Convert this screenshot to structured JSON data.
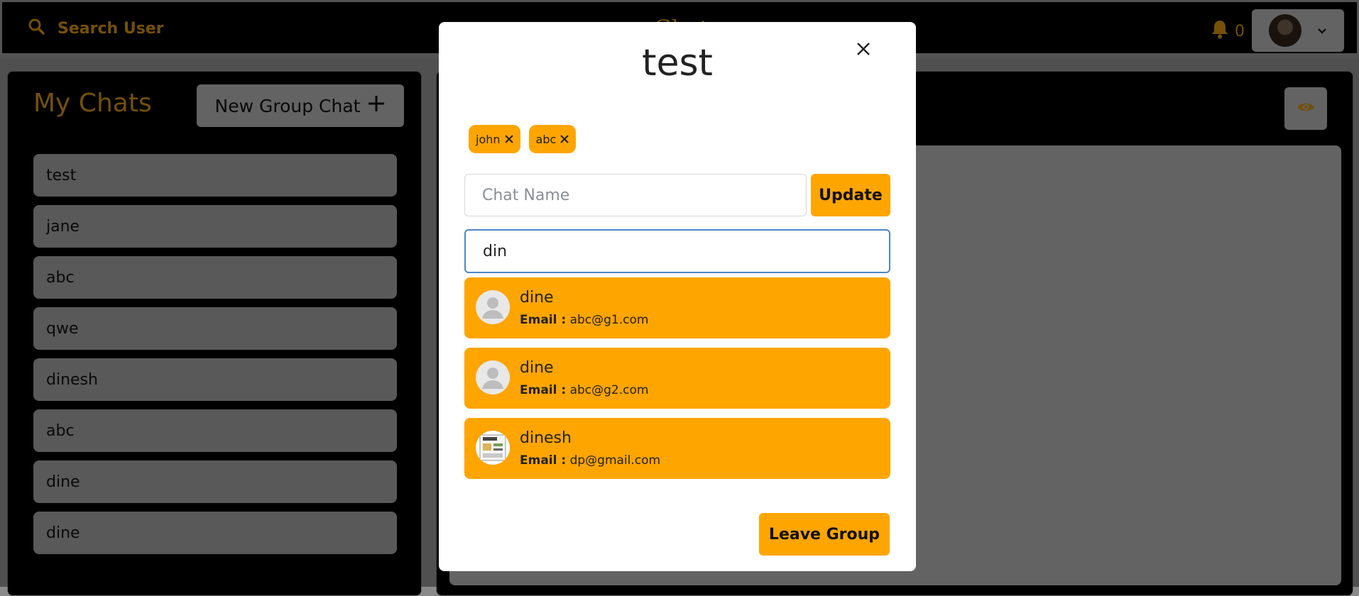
{
  "header": {
    "search_label": "Search User",
    "app_title": "Chat",
    "notification_count": "0",
    "accent_color": "#c88a12"
  },
  "sidebar": {
    "title": "My Chats",
    "new_group_label": "New Group Chat",
    "chats": [
      {
        "label": "test"
      },
      {
        "label": "jane"
      },
      {
        "label": "abc"
      },
      {
        "label": "qwe"
      },
      {
        "label": "dinesh"
      },
      {
        "label": "abc"
      },
      {
        "label": "dine"
      },
      {
        "label": "dine"
      }
    ]
  },
  "modal": {
    "title": "test",
    "members": [
      {
        "name": "john"
      },
      {
        "name": "abc"
      }
    ],
    "chat_name_placeholder": "Chat Name",
    "chat_name_value": "",
    "update_label": "Update",
    "add_user_value": "din",
    "search_results": [
      {
        "name": "dine",
        "email_label": "Email :",
        "email": "abc@g1.com",
        "avatar": "default-avatar-icon"
      },
      {
        "name": "dine",
        "email_label": "Email :",
        "email": "abc@g2.com",
        "avatar": "default-avatar-icon"
      },
      {
        "name": "dinesh",
        "email_label": "Email :",
        "email": "dp@gmail.com",
        "avatar": "photo"
      }
    ],
    "leave_label": "Leave Group",
    "button_color": "#ffa500"
  }
}
